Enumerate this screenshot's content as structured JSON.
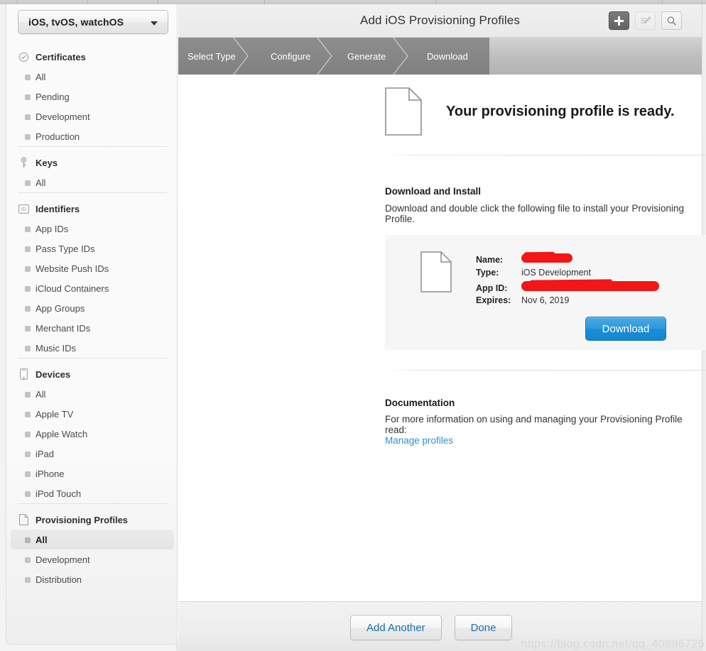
{
  "sidebar": {
    "platform_select": {
      "value": "iOS, tvOS, watchOS",
      "caret_icon": "chevron-down-icon"
    },
    "groups": [
      {
        "title": "Certificates",
        "icon": "certificate-seal-icon",
        "items": [
          {
            "label": "All",
            "selected": false
          },
          {
            "label": "Pending",
            "selected": false
          },
          {
            "label": "Development",
            "selected": false
          },
          {
            "label": "Production",
            "selected": false
          }
        ]
      },
      {
        "title": "Keys",
        "icon": "key-icon",
        "items": [
          {
            "label": "All",
            "selected": false
          }
        ]
      },
      {
        "title": "Identifiers",
        "icon": "identifier-id-icon",
        "items": [
          {
            "label": "App IDs",
            "selected": false
          },
          {
            "label": "Pass Type IDs",
            "selected": false
          },
          {
            "label": "Website Push IDs",
            "selected": false
          },
          {
            "label": "iCloud Containers",
            "selected": false
          },
          {
            "label": "App Groups",
            "selected": false
          },
          {
            "label": "Merchant IDs",
            "selected": false
          },
          {
            "label": "Music IDs",
            "selected": false
          }
        ]
      },
      {
        "title": "Devices",
        "icon": "device-phone-icon",
        "items": [
          {
            "label": "All",
            "selected": false
          },
          {
            "label": "Apple TV",
            "selected": false
          },
          {
            "label": "Apple Watch",
            "selected": false
          },
          {
            "label": "iPad",
            "selected": false
          },
          {
            "label": "iPhone",
            "selected": false
          },
          {
            "label": "iPod Touch",
            "selected": false
          }
        ]
      },
      {
        "title": "Provisioning Profiles",
        "icon": "document-icon",
        "items": [
          {
            "label": "All",
            "selected": true
          },
          {
            "label": "Development",
            "selected": false
          },
          {
            "label": "Distribution",
            "selected": false
          }
        ]
      }
    ]
  },
  "header": {
    "title": "Add iOS Provisioning Profiles",
    "actions": [
      {
        "name": "add-button",
        "icon": "plus-icon",
        "state": "active"
      },
      {
        "name": "edit-button",
        "icon": "pencil-edit-icon",
        "state": "disabled"
      },
      {
        "name": "search-button",
        "icon": "search-icon",
        "state": "enabled"
      }
    ]
  },
  "steps": {
    "items": [
      {
        "label": "Select Type",
        "active": true
      },
      {
        "label": "Configure",
        "active": true
      },
      {
        "label": "Generate",
        "active": true
      },
      {
        "label": "Download",
        "active": true
      }
    ],
    "current": "Download"
  },
  "content": {
    "hero": {
      "icon": "document-icon",
      "title": "Your provisioning profile is ready."
    },
    "download_section": {
      "heading": "Download and Install",
      "description": "Download and double click the following file to install your Provisioning Profile."
    },
    "profile_card": {
      "icon": "document-icon",
      "fields": [
        {
          "label": "Name:",
          "value": "",
          "redacted": true
        },
        {
          "label": "Type:",
          "value": "iOS Development",
          "redacted": false
        },
        {
          "label": "App ID:",
          "value": "",
          "redacted": true
        },
        {
          "label": "Expires:",
          "value": "Nov 6, 2019",
          "redacted": false
        }
      ],
      "download_button": "Download"
    },
    "documentation_section": {
      "heading": "Documentation",
      "description": "For more information on using and managing your Provisioning Profile read:",
      "link": "Manage profiles"
    }
  },
  "footer": {
    "add_another_label": "Add Another",
    "done_label": "Done"
  },
  "watermark": "https://blog.csdn.net/qq_40896725",
  "colors": {
    "accent_blue": "#2b93d1",
    "download_button": "#1b8ed6",
    "redaction_red": "#f21616",
    "step_active": "#878787",
    "step_inactive": "#bdbdbd",
    "sidebar_bg": "#fafafa"
  }
}
